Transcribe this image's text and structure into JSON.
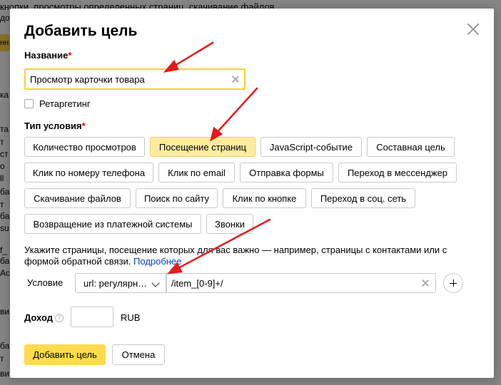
{
  "background": {
    "top_text": "кнопки, просмотры определенных страниц, скачивание файлов.",
    "fragments": [
      "до",
      "нн",
      "ка",
      "та",
      "т",
      "ст",
      "о",
      "ll",
      "ба",
      "т",
      "ба",
      "su",
      "f_",
      "ба",
      "Ac",
      "ви",
      "ба",
      "т",
      "ви"
    ]
  },
  "modal": {
    "title": "Добавить цель",
    "name_label": "Название",
    "required_mark": "*",
    "name_value": "Просмотр карточки товара",
    "retargeting_label": "Ретаргетинг",
    "condition_type_label": "Тип условия",
    "condition_types": [
      "Количество просмотров",
      "Посещение страниц",
      "JavaScript-событие",
      "Составная цель",
      "Клик по номеру телефона",
      "Клик по email",
      "Отправка формы",
      "Переход в мессенджер",
      "Скачивание файлов",
      "Поиск по сайту",
      "Клик по кнопке",
      "Переход в соц. сеть",
      "Возвращение из платежной системы",
      "Звонки"
    ],
    "selected_condition_type": "Посещение страниц",
    "hint_text": "Укажите страницы, посещение которых для вас важно — например, страницы с контактами или с формой обратной связи.",
    "hint_link": "Подробнее",
    "condition_label": "Условие",
    "condition_select_value": "url: регулярн…",
    "condition_url_value": "/item_[0-9]+/",
    "income_label": "Доход",
    "income_help": "?",
    "income_value": "",
    "currency": "RUB",
    "submit_label": "Добавить цель",
    "cancel_label": "Отмена"
  },
  "colors": {
    "accent_yellow": "#ffdb4d",
    "selected_chip": "#ffeba0",
    "required_red": "#e00000",
    "link_blue": "#0044bb",
    "annotation_arrow": "#e31b1b"
  },
  "icons": [
    "close-icon",
    "clear-icon",
    "chevron-down-icon",
    "plus-icon",
    "help-icon",
    "annotation-arrow"
  ]
}
